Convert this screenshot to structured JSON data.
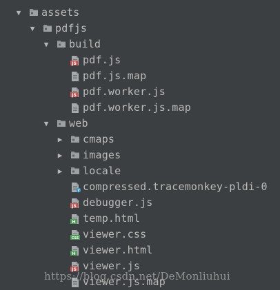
{
  "tree": [
    {
      "label": "assets",
      "type": "folder",
      "arrow": "▼"
    },
    {
      "label": "pdfjs",
      "type": "folder",
      "arrow": "▼"
    },
    {
      "label": "build",
      "type": "folder",
      "arrow": "▼"
    },
    {
      "label": "pdf.js",
      "type": "file-js"
    },
    {
      "label": "pdf.js.map",
      "type": "file-text"
    },
    {
      "label": "pdf.worker.js",
      "type": "file-js"
    },
    {
      "label": "pdf.worker.js.map",
      "type": "file-text"
    },
    {
      "label": "web",
      "type": "folder",
      "arrow": "▼"
    },
    {
      "label": "cmaps",
      "type": "folder",
      "arrow": "▶"
    },
    {
      "label": "images",
      "type": "folder",
      "arrow": "▶"
    },
    {
      "label": "locale",
      "type": "folder",
      "arrow": "▶"
    },
    {
      "label": "compressed.tracemonkey-pldi-0",
      "type": "file-unknown"
    },
    {
      "label": "debugger.js",
      "type": "file-js"
    },
    {
      "label": "temp.html",
      "type": "file-html"
    },
    {
      "label": "viewer.css",
      "type": "file-css"
    },
    {
      "label": "viewer.html",
      "type": "file-html"
    },
    {
      "label": "viewer.js",
      "type": "file-js"
    },
    {
      "label": "viewer.js.map",
      "type": "file-text"
    }
  ],
  "icons": {
    "folder": "folder-icon",
    "file-js": "javascript-file-icon",
    "file-text": "text-file-icon",
    "file-unknown": "unknown-file-icon",
    "file-html": "html-file-icon",
    "file-css": "css-file-icon"
  },
  "colors": {
    "background": "#3c3f41",
    "text": "#bbbbbb",
    "folder": "#8f9396",
    "js_badge": "#c75450",
    "html_badge": "#499c54",
    "css_badge": "#499c54",
    "unknown_badge": "#3592c4",
    "file_page": "#a7aaad"
  },
  "watermark": "https://blog.csdn.net/DeMonliuhui"
}
